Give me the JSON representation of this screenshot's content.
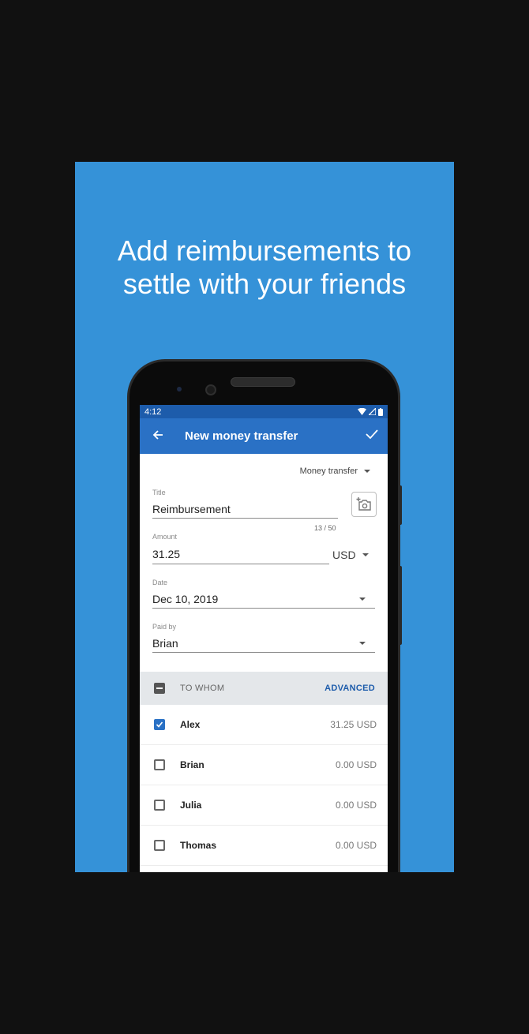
{
  "headline": {
    "line1": "Add reimbursements to",
    "line2": "settle with your friends"
  },
  "status_bar": {
    "time": "4:12"
  },
  "app_bar": {
    "title": "New money transfer"
  },
  "form": {
    "transfer_type": "Money transfer",
    "title": {
      "label": "Title",
      "value": "Reimbursement",
      "counter": "13 / 50"
    },
    "amount": {
      "label": "Amount",
      "value": "31.25",
      "currency": "USD"
    },
    "date": {
      "label": "Date",
      "value": "Dec 10, 2019"
    },
    "paid_by": {
      "label": "Paid by",
      "value": "Brian"
    }
  },
  "to_whom": {
    "label": "TO WHOM",
    "advanced_label": "ADVANCED",
    "people": [
      {
        "name": "Alex",
        "amount": "31.25 USD",
        "checked": true
      },
      {
        "name": "Brian",
        "amount": "0.00 USD",
        "checked": false
      },
      {
        "name": "Julia",
        "amount": "0.00 USD",
        "checked": false
      },
      {
        "name": "Thomas",
        "amount": "0.00 USD",
        "checked": false
      }
    ]
  },
  "colors": {
    "background": "#3592d8",
    "app_bar": "#2a71c5",
    "status_bar": "#1d5cab",
    "accent": "#1d5cab"
  }
}
